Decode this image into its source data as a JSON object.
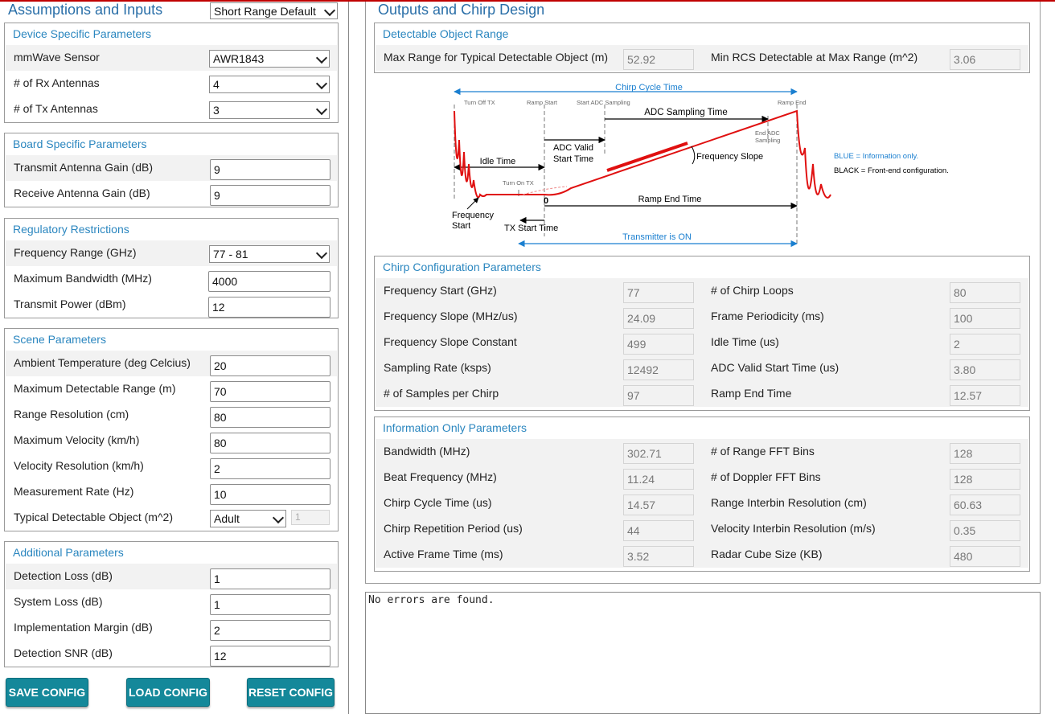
{
  "left": {
    "title": "Assumptions and Inputs",
    "preset": "Short Range Default",
    "device": {
      "title": "Device Specific Parameters",
      "rows": [
        {
          "label": "mmWave Sensor",
          "value": "AWR1843"
        },
        {
          "label": "# of Rx Antennas",
          "value": "4"
        },
        {
          "label": "# of Tx Antennas",
          "value": "3"
        }
      ]
    },
    "board": {
      "title": "Board Specific Parameters",
      "rows": [
        {
          "label": "Transmit Antenna Gain (dB)",
          "value": "9"
        },
        {
          "label": "Receive Antenna Gain (dB)",
          "value": "9"
        }
      ]
    },
    "regulatory": {
      "title": "Regulatory Restrictions",
      "rows": [
        {
          "label": "Frequency Range (GHz)",
          "value": "77 - 81"
        },
        {
          "label": "Maximum Bandwidth (MHz)",
          "value": "4000"
        },
        {
          "label": "Transmit Power (dBm)",
          "value": "12"
        }
      ]
    },
    "scene": {
      "title": "Scene Parameters",
      "rows": [
        {
          "label": "Ambient Temperature (deg Celcius)",
          "value": "20"
        },
        {
          "label": "Maximum Detectable Range (m)",
          "value": "70"
        },
        {
          "label": "Range Resolution (cm)",
          "value": "80"
        },
        {
          "label": "Maximum Velocity (km/h)",
          "value": "80"
        },
        {
          "label": "Velocity Resolution (km/h)",
          "value": "2"
        },
        {
          "label": "Measurement Rate (Hz)",
          "value": "10"
        },
        {
          "label": "Typical Detectable Object (m^2)",
          "value": "Adult",
          "extra": "1"
        }
      ]
    },
    "additional": {
      "title": "Additional Parameters",
      "rows": [
        {
          "label": "Detection Loss (dB)",
          "value": "1"
        },
        {
          "label": "System Loss (dB)",
          "value": "1"
        },
        {
          "label": "Implementation Margin (dB)",
          "value": "2"
        },
        {
          "label": "Detection SNR (dB)",
          "value": "12"
        }
      ]
    },
    "buttons": {
      "save": "SAVE CONFIG",
      "load": "LOAD CONFIG",
      "reset": "RESET CONFIG"
    }
  },
  "right": {
    "title": "Outputs and Chirp Design",
    "detectable": {
      "title": "Detectable Object Range",
      "max_range_label": "Max Range for Typical Detectable Object (m)",
      "max_range_value": "52.92",
      "min_rcs_label": "Min RCS Detectable at Max Range (m^2)",
      "min_rcs_value": "3.06"
    },
    "diagram": {
      "chirp_cycle_time": "Chirp Cycle Time",
      "turn_off_tx": "Turn Off TX",
      "ramp_start": "Ramp Start",
      "start_adc": "Start ADC Sampling",
      "ramp_end": "Ramp End",
      "adc_sampling_time": "ADC Sampling Time",
      "end_adc_1": "End ADC",
      "end_adc_2": "Sampling",
      "adc_valid_1": "ADC Valid",
      "adc_valid_2": "Start Time",
      "idle_time": "Idle Time",
      "frequency_slope": "Frequency Slope",
      "turn_on_tx": "Turn On TX",
      "zero": "0",
      "ramp_end_time": "Ramp End Time",
      "freq_start_1": "Frequency",
      "freq_start_2": "Start",
      "tx_start_time": "TX Start Time",
      "transmitter_on": "Transmitter is ON",
      "legend_blue": "BLUE = Information only.",
      "legend_black": "BLACK = Front-end configuration."
    },
    "chirp": {
      "title": "Chirp Configuration Parameters",
      "left": [
        {
          "label": "Frequency Start (GHz)",
          "value": "77"
        },
        {
          "label": "Frequency Slope (MHz/us)",
          "value": "24.09"
        },
        {
          "label": "Frequency Slope Constant",
          "value": "499"
        },
        {
          "label": "Sampling Rate (ksps)",
          "value": "12492"
        },
        {
          "label": "# of Samples per Chirp",
          "value": "97"
        }
      ],
      "right": [
        {
          "label": "# of Chirp Loops",
          "value": "80"
        },
        {
          "label": "Frame Periodicity (ms)",
          "value": "100"
        },
        {
          "label": "Idle Time (us)",
          "value": "2"
        },
        {
          "label": "ADC Valid Start Time (us)",
          "value": "3.80"
        },
        {
          "label": "Ramp End Time",
          "value": "12.57"
        }
      ]
    },
    "info": {
      "title": "Information Only Parameters",
      "left": [
        {
          "label": "Bandwidth (MHz)",
          "value": "302.71"
        },
        {
          "label": "Beat Frequency (MHz)",
          "value": "11.24"
        },
        {
          "label": "Chirp Cycle Time (us)",
          "value": "14.57"
        },
        {
          "label": "Chirp Repetition Period (us)",
          "value": "44"
        },
        {
          "label": "Active Frame Time (ms)",
          "value": "3.52"
        }
      ],
      "right": [
        {
          "label": "# of Range FFT Bins",
          "value": "128"
        },
        {
          "label": "# of Doppler FFT Bins",
          "value": "128"
        },
        {
          "label": "Range Interbin Resolution (cm)",
          "value": "60.63"
        },
        {
          "label": "Velocity Interbin Resolution (m/s)",
          "value": "0.35"
        },
        {
          "label": "Radar Cube Size (KB)",
          "value": "480"
        }
      ]
    },
    "log": "No errors are found."
  }
}
